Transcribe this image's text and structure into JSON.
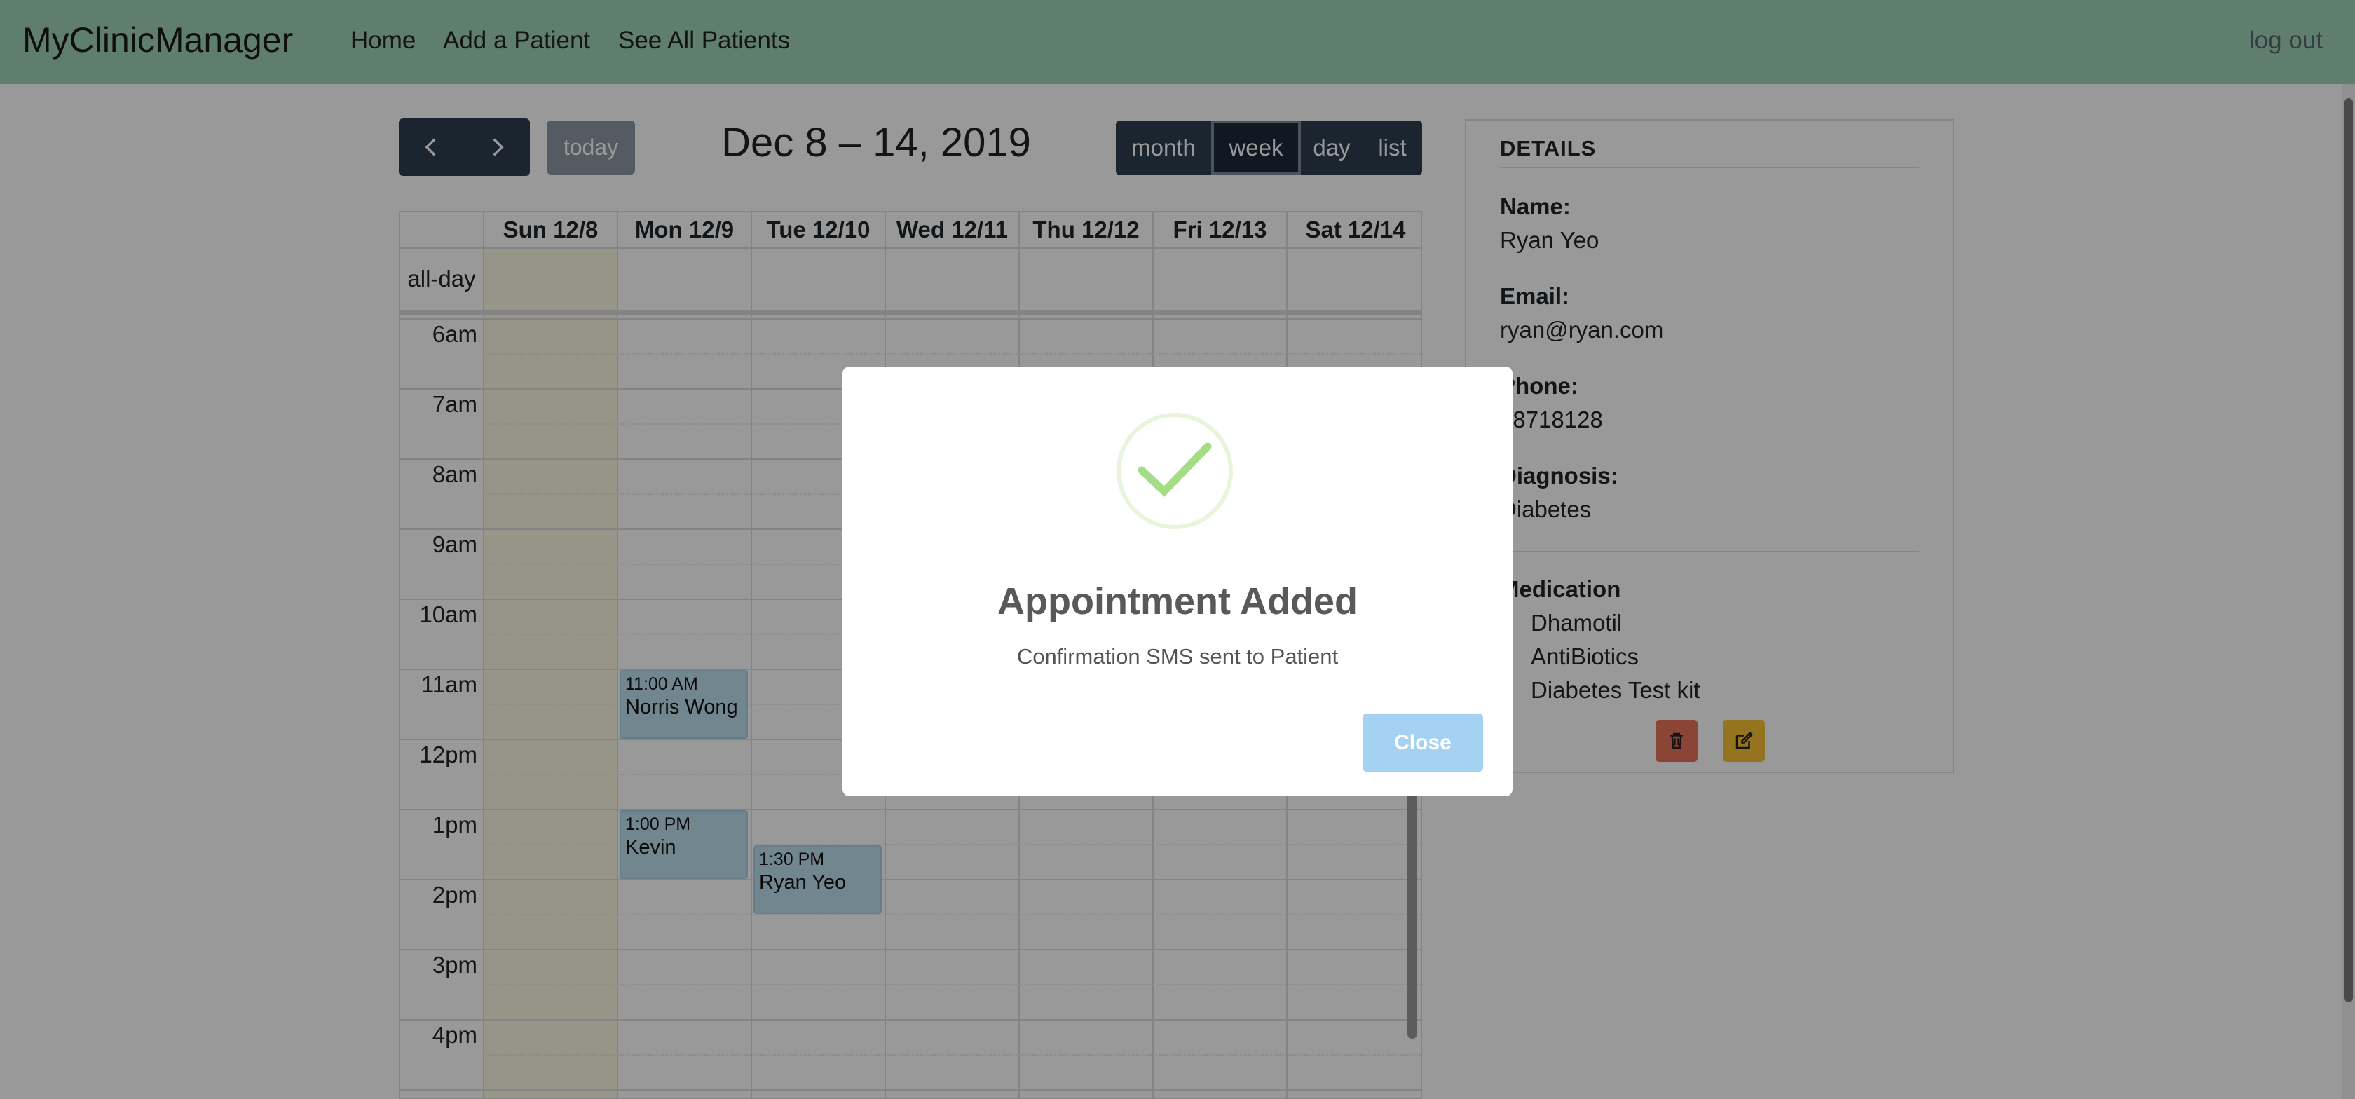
{
  "navbar": {
    "brand": "MyClinicManager",
    "links": [
      "Home",
      "Add a Patient",
      "See All Patients"
    ],
    "logout": "log out",
    "bg_color": "#9fd3b8"
  },
  "toolbar": {
    "prev_icon": "chevron-left-icon",
    "next_icon": "chevron-right-icon",
    "today_label": "today",
    "title": "Dec 8 – 14, 2019",
    "views": [
      "month",
      "week",
      "day",
      "list"
    ],
    "active_view": "week"
  },
  "calendar": {
    "all_day_label": "all-day",
    "days": [
      "Sun 12/8",
      "Mon 12/9",
      "Tue 12/10",
      "Wed 12/11",
      "Thu 12/12",
      "Fri 12/13",
      "Sat 12/14"
    ],
    "today_index": 0,
    "hours": [
      "6am",
      "7am",
      "8am",
      "9am",
      "10am",
      "11am",
      "12pm",
      "1pm",
      "2pm",
      "3pm",
      "4pm"
    ],
    "events": [
      {
        "time": "11:00 AM",
        "title": "Norris Wong"
      },
      {
        "time": "1:00 PM",
        "title": "Kevin"
      },
      {
        "time": "1:30 PM",
        "title": "Ryan Yeo"
      }
    ]
  },
  "details": {
    "heading": "DETAILS",
    "name_label": "Name:",
    "name": "Ryan Yeo",
    "email_label": "Email:",
    "email": "ryan@ryan.com",
    "phone_label": "Phone:",
    "phone": "38718128",
    "diagnosis_label": "Diagnosis:",
    "diagnosis": "Diabetes",
    "medication_label": "Medication",
    "medications": [
      "Dhamotil",
      "AntiBiotics",
      "Diabetes Test kit"
    ],
    "delete_icon": "trash-icon",
    "edit_icon": "edit-icon"
  },
  "modal": {
    "icon": "success-check-icon",
    "title": "Appointment Added",
    "text": "Confirmation SMS sent to Patient",
    "close_label": "Close"
  }
}
